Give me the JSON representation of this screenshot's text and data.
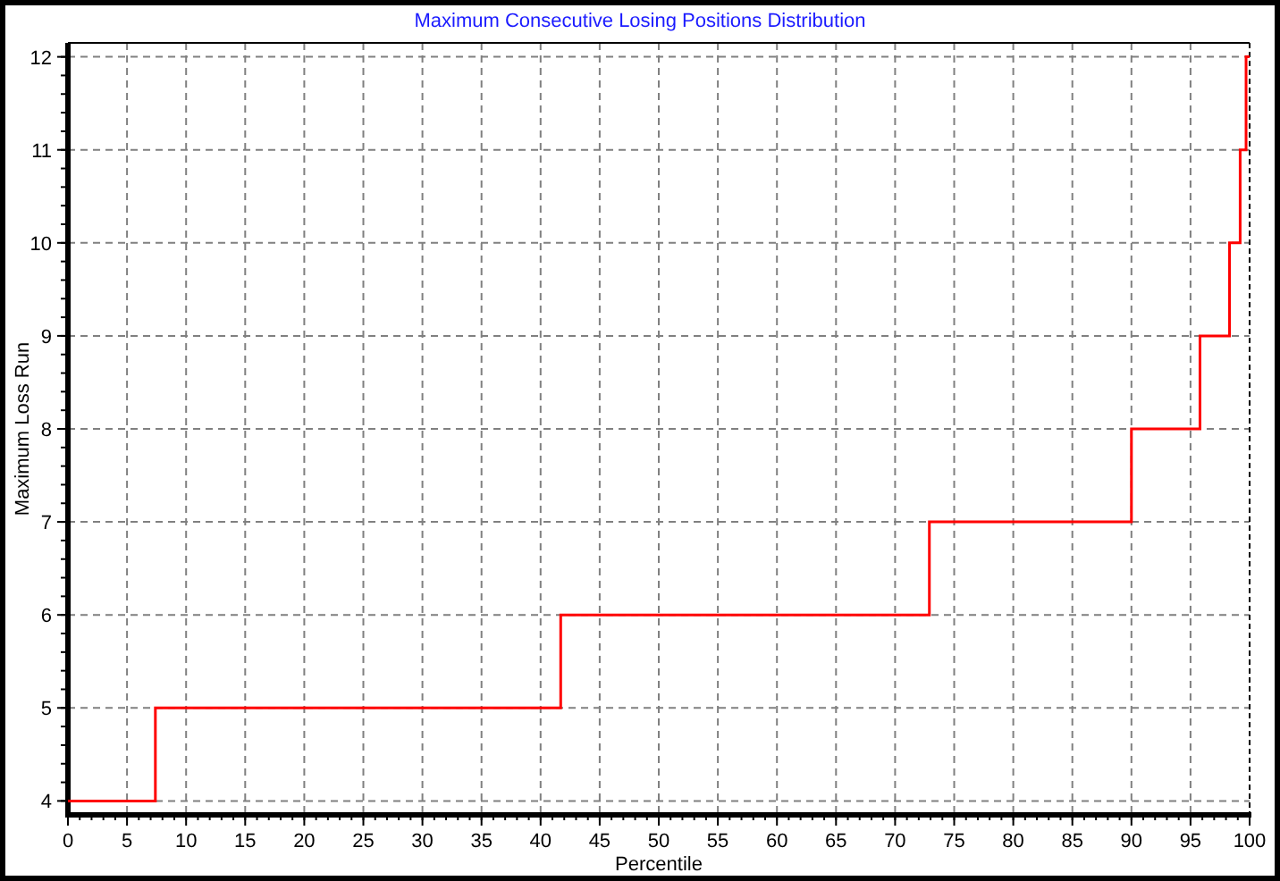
{
  "chart": {
    "chart_data": {
      "type": "line",
      "title": "Maximum Consecutive Losing Positions Distribution",
      "xlabel": "Percentile",
      "ylabel": "Maximum Loss Run",
      "grid": true,
      "x": [
        0,
        7.4,
        7.4,
        41.7,
        41.7,
        72.9,
        72.9,
        90,
        90,
        95.8,
        95.8,
        98.3,
        98.3,
        99.2,
        99.2,
        99.7,
        99.7,
        100
      ],
      "series": [
        {
          "color": "#ff0000",
          "values": [
            4,
            4,
            5,
            5,
            6,
            6,
            7,
            7,
            8,
            8,
            9,
            9,
            10,
            10,
            11,
            11,
            12,
            12
          ]
        }
      ],
      "xlim": [
        0,
        100
      ],
      "ylim": [
        3.85,
        12.15
      ],
      "xticks": [
        0,
        5,
        10,
        15,
        20,
        25,
        30,
        35,
        40,
        45,
        50,
        55,
        60,
        65,
        70,
        75,
        80,
        85,
        90,
        95,
        100
      ],
      "yticks": [
        4,
        5,
        6,
        7,
        8,
        9,
        10,
        11,
        12
      ]
    }
  }
}
